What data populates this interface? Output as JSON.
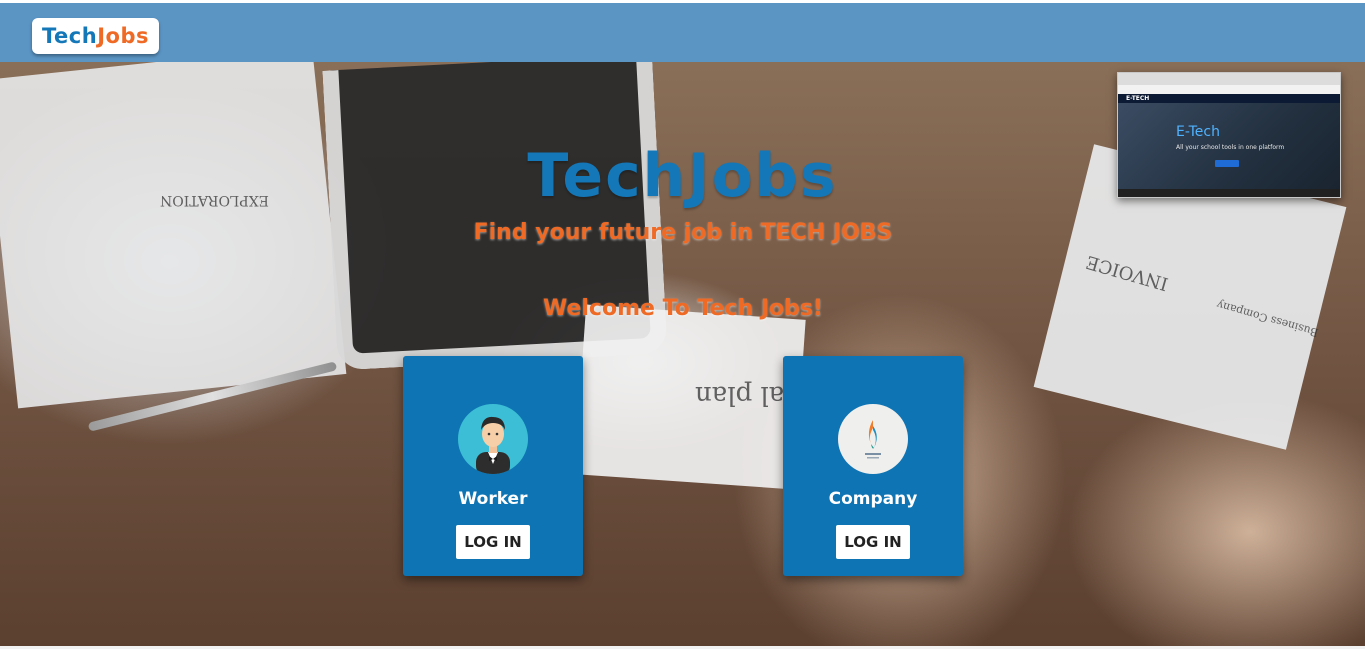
{
  "header": {
    "logo_part1": "Tech",
    "logo_part2": "Jobs"
  },
  "hero": {
    "logo_part1": "Tech",
    "logo_part2": "Jobs",
    "tagline": "Find your future job in TECH JOBS",
    "welcome": "Welcome To Tech Jobs!",
    "background_text": {
      "exploration": "EXPLORATION",
      "invoice": "INVOICE",
      "business_company": "Business Company",
      "plan": "al plan"
    }
  },
  "preview_window": {
    "brand": "E-TECH",
    "title": "E-Tech",
    "subtitle": "All your school tools in one platform"
  },
  "cards": [
    {
      "label": "Worker",
      "button": "LOG IN",
      "icon": "worker-avatar-icon"
    },
    {
      "label": "Company",
      "button": "LOG IN",
      "icon": "company-logo-icon"
    }
  ],
  "colors": {
    "header": "#5b95c4",
    "brand_blue": "#1477b8",
    "brand_orange": "#ee6a25",
    "card": "#0e74b3"
  }
}
